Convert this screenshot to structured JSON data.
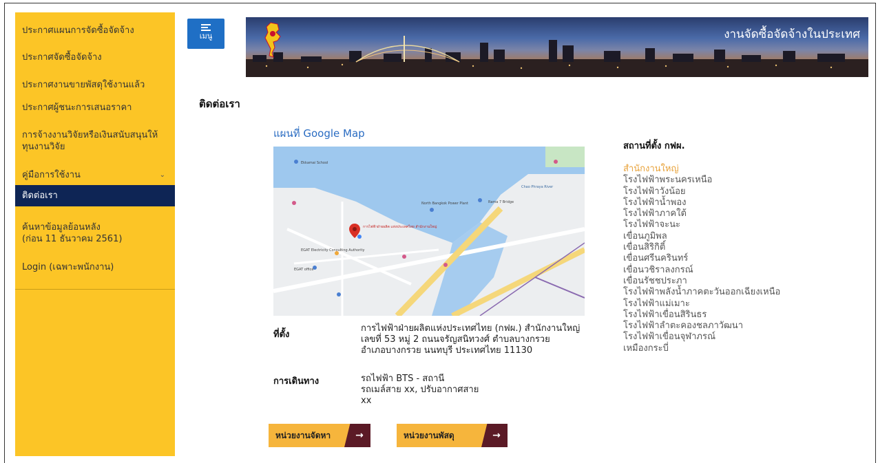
{
  "sidebar": {
    "items": [
      {
        "label": "ประกาศแผนการจัดซื้อจัดจ้าง"
      },
      {
        "label": "ประกาศจัดซื้อจัดจ้าง"
      },
      {
        "label": "ประกาศงานขายพัสดุใช้งานแล้ว"
      },
      {
        "label": "ประกาศผู้ชนะการเสนอราคา"
      },
      {
        "label_line1": "การจ้างงานวิจัยหรือเงินสนับสนุนให้",
        "label_line2": "ทุนงานวิจัย"
      },
      {
        "label": "คู่มือการใช้งาน",
        "chevron": "chevron-down-icon"
      },
      {
        "label": "ติดต่อเรา",
        "active": true
      },
      {
        "label_line1": "ค้นหาข้อมูลย้อนหลัง",
        "label_line2": "(ก่อน 11 ธันวาคม 2561)"
      },
      {
        "label": "Login (เฉพาะพนักงาน)"
      }
    ],
    "bg_color": "#fcc526",
    "active_color": "#0e2555"
  },
  "header": {
    "menu_label": "เมนู",
    "menu_icon": "hamburger-icon",
    "banner_title": "งานจัดซื้อจัดจ้างในประเทศ",
    "logo_icon": "thailand-map-logo-icon"
  },
  "page": {
    "title": "ติดต่อเรา",
    "map_title": "แผนที่ Google Map"
  },
  "contact": {
    "address_label": "ที่ตั้ง",
    "address_lines": [
      "การไฟฟ้าฝ่ายผลิตแห่งประเทศไทย (กฟผ.) สำนักงานใหญ่",
      "เลขที่ 53 หมู่ 2 ถนนจรัญสนิทวงศ์ ตำบลบางกรวย",
      "อำเภอบางกรวย นนทบุรี ประเทศไทย 11130"
    ],
    "travel_label": "การเดินทาง",
    "travel_lines": [
      "รถไฟฟ้า BTS - สถานี",
      "รถเมล์สาย xx, ปรับอากาศสาย",
      "xx"
    ]
  },
  "buttons": {
    "procurement_unit": "หน่วยงานจัดหา",
    "supplies_unit": "หน่วยงานพัสดุ",
    "arrow": "→"
  },
  "locations": {
    "heading": "สถานที่ตั้ง กฟผ.",
    "items": [
      "สำนักงานใหญ่",
      "โรงไฟฟ้าพระนครเหนือ",
      "โรงไฟฟ้าวังน้อย",
      "โรงไฟฟ้าน้ำพอง",
      "โรงไฟฟ้าภาคใต้",
      "โรงไฟฟ้าจะนะ",
      "เขื่อนภูมิพล",
      "เขื่อนสิริกิติ์",
      "เขื่อนศรีนครินทร์",
      "เขื่อนวชิราลงกรณ์",
      "เขื่อนรัชชประภา",
      "โรงไฟฟ้าพลังน้ำภาคตะวันออกเฉียงเหนือ",
      "โรงไฟฟ้าแม่เมาะ",
      "โรงไฟฟ้าเขื่อนสิรินธร",
      "โรงไฟฟ้าลำตะคองชลภาวัฒนา",
      "โรงไฟฟ้าเขื่อนจุฬาภรณ์",
      "เหมืองกระบี่"
    ],
    "active_color": "#e8a23a"
  },
  "map": {
    "labels": {
      "ekoch": "Ekkamai School",
      "north": "North Bangkok Power Plant",
      "egat_hq": "การไฟฟ้าฝ่ายผลิต แห่งประเทศไทย สำนักงานใหญ่",
      "egat_consult": "EGAT Electricity Consulting Authority",
      "egat_office": "EGAT office",
      "bridge": "Rama 7 Bridge",
      "chao": "Chao Phraya River"
    }
  }
}
